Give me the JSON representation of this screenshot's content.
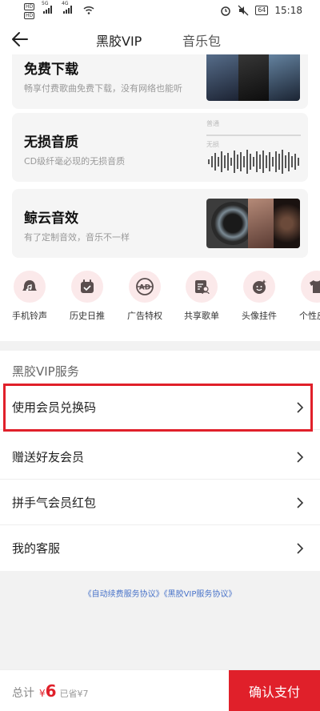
{
  "status_bar": {
    "sim1": "HD",
    "sim2": "HD",
    "net1": "5G",
    "net2": "4G",
    "battery": "64",
    "time": "15:18"
  },
  "nav": {
    "tabs": [
      {
        "label": "黑胶VIP",
        "active": true
      },
      {
        "label": "音乐包",
        "active": false
      }
    ]
  },
  "features": [
    {
      "title": "免费下载",
      "desc": "畅享付费歌曲免费下载，没有网络也能听"
    },
    {
      "title": "无损音质",
      "desc": "CD级纤毫必现的无损音质",
      "wave_labels": [
        "普通",
        "无损"
      ]
    },
    {
      "title": "鲸云音效",
      "desc": "有了定制音效，音乐不一样"
    }
  ],
  "perks": [
    {
      "label": "手机铃声",
      "icon": "ringtone-icon"
    },
    {
      "label": "历史日推",
      "icon": "calendar-icon"
    },
    {
      "label": "广告特权",
      "icon": "ad-free-icon"
    },
    {
      "label": "共享歌单",
      "icon": "shared-playlist-icon"
    },
    {
      "label": "头像挂件",
      "icon": "avatar-pendant-icon"
    },
    {
      "label": "个性皮肤",
      "icon": "tshirt-icon"
    }
  ],
  "services": {
    "title": "黑胶VIP服务",
    "items": [
      {
        "label": "使用会员兑换码",
        "highlighted": true
      },
      {
        "label": "赠送好友会员"
      },
      {
        "label": "拼手气会员红包"
      },
      {
        "label": "我的客服"
      }
    ]
  },
  "agreements": [
    "《自动续费服务协议》",
    "《黑胶VIP服务协议》"
  ],
  "footer": {
    "total_label": "总计",
    "currency": "¥",
    "price": "6",
    "saved": "已省¥7",
    "pay_label": "确认支付"
  },
  "colors": {
    "accent": "#e0202a",
    "link": "#4a74c9",
    "icon_bg": "#fbe9ea"
  }
}
